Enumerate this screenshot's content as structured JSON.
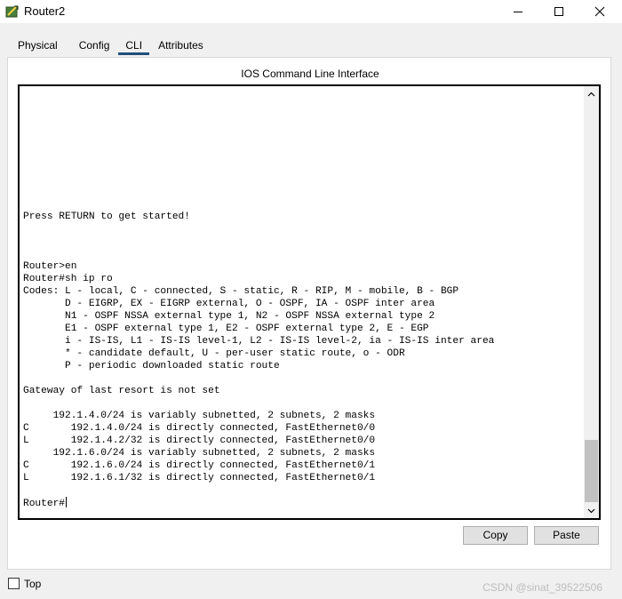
{
  "window": {
    "title": "Router2"
  },
  "tabs": [
    {
      "label": "Physical",
      "active": false
    },
    {
      "label": "Config",
      "active": false
    },
    {
      "label": "CLI",
      "active": true
    },
    {
      "label": "Attributes",
      "active": false
    }
  ],
  "cli": {
    "title": "IOS Command Line Interface",
    "lines": [
      "",
      "",
      "",
      "",
      "",
      "",
      "",
      "",
      "",
      "",
      "Press RETURN to get started!",
      "",
      "",
      "",
      "Router>en",
      "Router#sh ip ro",
      "Codes: L - local, C - connected, S - static, R - RIP, M - mobile, B - BGP",
      "       D - EIGRP, EX - EIGRP external, O - OSPF, IA - OSPF inter area",
      "       N1 - OSPF NSSA external type 1, N2 - OSPF NSSA external type 2",
      "       E1 - OSPF external type 1, E2 - OSPF external type 2, E - EGP",
      "       i - IS-IS, L1 - IS-IS level-1, L2 - IS-IS level-2, ia - IS-IS inter area",
      "       * - candidate default, U - per-user static route, o - ODR",
      "       P - periodic downloaded static route",
      "",
      "Gateway of last resort is not set",
      "",
      "     192.1.4.0/24 is variably subnetted, 2 subnets, 2 masks",
      "C       192.1.4.0/24 is directly connected, FastEthernet0/0",
      "L       192.1.4.2/32 is directly connected, FastEthernet0/0",
      "     192.1.6.0/24 is variably subnetted, 2 subnets, 2 masks",
      "C       192.1.6.0/24 is directly connected, FastEthernet0/1",
      "L       192.1.6.1/32 is directly connected, FastEthernet0/1",
      ""
    ],
    "prompt": "Router#",
    "scroll_position": 0.82
  },
  "buttons": {
    "copy": "Copy",
    "paste": "Paste"
  },
  "footer": {
    "top_label": "Top",
    "top_checked": false,
    "watermark": "CSDN @sinat_39522506"
  },
  "icons": {
    "app": "router-app-icon",
    "minimize": "minimize-icon",
    "maximize": "maximize-icon",
    "close": "close-icon"
  }
}
